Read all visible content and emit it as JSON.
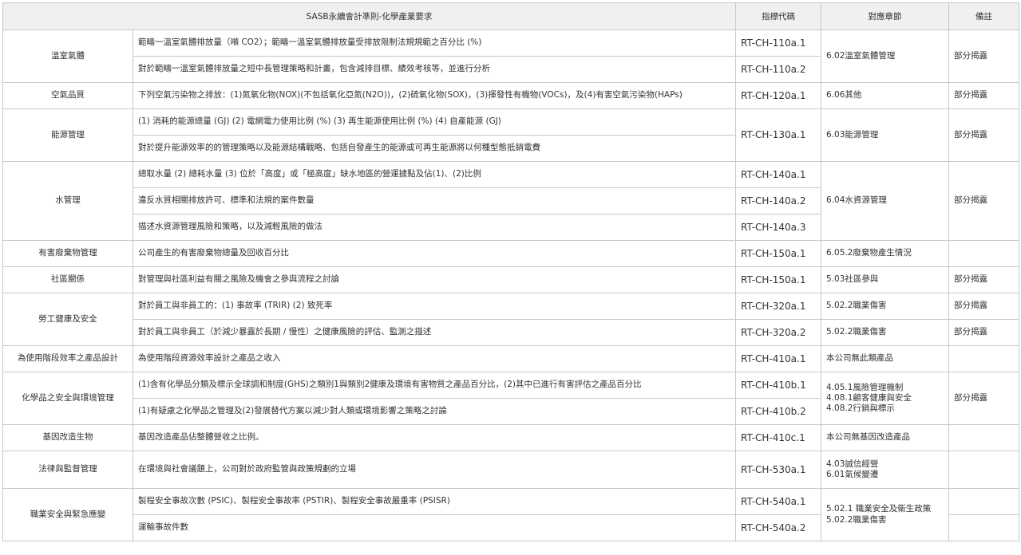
{
  "headers": {
    "standard": "SASB永續會計準則-化學產業要求",
    "code": "指標代碼",
    "chapter": "對應章節",
    "note": "備註"
  },
  "rows": {
    "ghg_1": {
      "topic": "溫室氣體",
      "metric": "範疇一溫室氣體排放量（噸 CO2）；範疇一溫室氣體排放量受排放限制法規規範之百分比 (%)",
      "code": "RT-CH-110a.1",
      "chapter": "6.02溫室氣體管理",
      "note": "部分揭露"
    },
    "ghg_2": {
      "metric": "對於範疇一溫室氣體排放量之短中長管理策略和計畫，包含減排目標、績效考核等，並進行分析",
      "code": "RT-CH-110a.2"
    },
    "air": {
      "topic": "空氣品質",
      "metric": "下列空氣污染物之排放：(1)氮氧化物(NOX)(不包括氧化亞氮(N2O))，(2)硫氧化物(SOX)，(3)揮發性有機物(VOCs)，及(4)有害空氣污染物(HAPs)",
      "code": "RT-CH-120a.1",
      "chapter": "6.06其他",
      "note": "部分揭露"
    },
    "energy_1": {
      "topic": "能源管理",
      "metric": "(1) 消耗的能源總量 (GJ) (2) 電網電力使用比例 (%) (3) 再生能源使用比例 (%) (4) 自產能源 (GJ)",
      "code": "RT-CH-130a.1",
      "chapter": "6.03能源管理",
      "note": "部分揭露"
    },
    "energy_2": {
      "metric": "對於提升能源效率的的管理策略以及能源結構戰略、包括自發產生的能源或可再生能源將以何種型態抵銷電費"
    },
    "water_1": {
      "topic": "水管理",
      "metric": "總取水量 (2) 總耗水量 (3) 位於「高度」或「極高度」缺水地區的營運據點及佔(1)、(2)比例",
      "code": "RT-CH-140a.1",
      "chapter": "6.04水資源管理",
      "note": "部分揭露"
    },
    "water_2": {
      "metric": "違反水質相關排放許可、標準和法規的案件數量",
      "code": "RT-CH-140a.2"
    },
    "water_3": {
      "metric": "描述水資源管理風險和策略，以及減輕風險的做法",
      "code": "RT-CH-140a.3"
    },
    "waste": {
      "topic": "有害廢棄物管理",
      "metric": "公司產生的有害廢棄物總量及回收百分比",
      "code": "RT-CH-150a.1",
      "chapter": "6.05.2廢棄物產生情況",
      "note": ""
    },
    "community": {
      "topic": "社區關係",
      "metric": "對管理與社區利益有關之風險及機會之參與流程之討論",
      "code": "RT-CH-150a.1",
      "chapter": "5.03社區參與",
      "note": "部分揭露"
    },
    "health_1": {
      "topic": "勞工健康及安全",
      "metric": "對於員工與非員工的：(1) 事故率 (TRIR) (2) 致死率",
      "code": "RT-CH-320a.1",
      "chapter": "5.02.2職業傷害",
      "note": "部分揭露"
    },
    "health_2": {
      "metric": "對於員工與非員工（於減少暴露於長期 / 慢性）之健康風險的評估、監測之描述",
      "code": "RT-CH-320a.2",
      "chapter": "5.02.2職業傷害",
      "note": "部分揭露"
    },
    "design": {
      "topic": "為使用階段效率之產品設計",
      "metric": "為使用階段資源效率設計之產品之收入",
      "code": "RT-CH-410a.1",
      "chapter": "本公司無此類產品",
      "note": ""
    },
    "chem_1": {
      "topic": "化學品之安全與環境管理",
      "metric": "(1)含有化學品分類及標示全球調和制度(GHS)之類別1與類別2健康及環境有害物質之產品百分比，(2)其中已進行有害評估之產品百分比",
      "code": "RT-CH-410b.1",
      "chapter_lines": [
        "4.05.1風險管理機制",
        "4.08.1顧客健康與安全",
        "4.08.2行銷與標示"
      ],
      "note": "部分揭露"
    },
    "chem_2": {
      "metric": "(1)有疑慮之化學品之管理及(2)發展替代方案以減少對人類或環境影響之策略之討論",
      "code": "RT-CH-410b.2"
    },
    "gmo": {
      "topic": "基因改造生物",
      "metric": "基因改造產品佔整體營收之比例。",
      "code": "RT-CH-410c.1",
      "chapter": "本公司無基因改造產品",
      "note": ""
    },
    "legal": {
      "topic": "法律與監督管理",
      "metric": "在環境與社會議題上，公司對於政府監管與政策規劃的立場",
      "code": "RT-CH-530a.1",
      "chapter_lines": [
        "4.03誠信經營",
        "6.01氣候變遷"
      ],
      "note": ""
    },
    "safety_1": {
      "topic": "職業安全與緊急應變",
      "metric": "製程安全事故次數 (PSIC)、製程安全事故率 (PSTIR)、製程安全事故嚴重率 (PSISR)",
      "code": "RT-CH-540a.1",
      "chapter_lines": [
        "5.02.1 職業安全及衛生政策",
        "5.02.2職業傷害"
      ],
      "note": ""
    },
    "safety_2": {
      "metric": "運輸事故件數",
      "code": "RT-CH-540a.2"
    }
  }
}
